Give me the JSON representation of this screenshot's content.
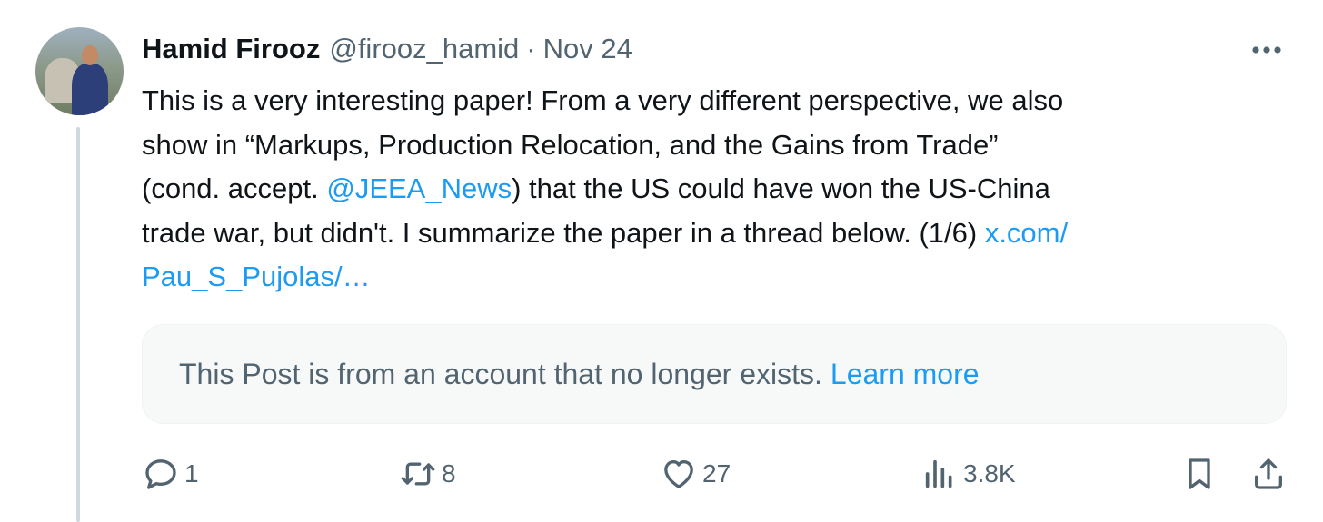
{
  "author": {
    "name": "Hamid Firooz",
    "handle": "@firooz_hamid",
    "separator": "·",
    "date": "Nov 24"
  },
  "tweet": {
    "line1": "This is a very interesting paper! From a very different perspective, we also",
    "line2": "show in “Markups, Production Relocation, and the Gains from Trade”",
    "line3_before": "(cond. accept. ",
    "mention": "@JEEA_News",
    "line3_after": ") that the US could have won the US-China",
    "line4": "trade war, but didn't. I summarize the paper in a thread below. (1/6) ",
    "link_part1": "x.com/",
    "link_part2": "Pau_S_Pujolas/…"
  },
  "quoted_notice": {
    "text": "This Post is from an account that no longer exists.",
    "link_label": "Learn more"
  },
  "actions": {
    "replies": "1",
    "reposts": "8",
    "likes": "27",
    "views": "3.8K"
  },
  "icons": {
    "more": "more-horizontal-icon",
    "reply": "reply-bubble-icon",
    "repost": "repost-arrows-icon",
    "like": "heart-icon",
    "views": "bar-chart-icon",
    "bookmark": "bookmark-icon",
    "share": "share-upload-icon"
  },
  "colors": {
    "link": "#1d9bf0",
    "secondary_text": "#536471",
    "primary_text": "#0f1419",
    "thread_line": "#cfd9de",
    "notice_bg": "#f7f9f9"
  }
}
